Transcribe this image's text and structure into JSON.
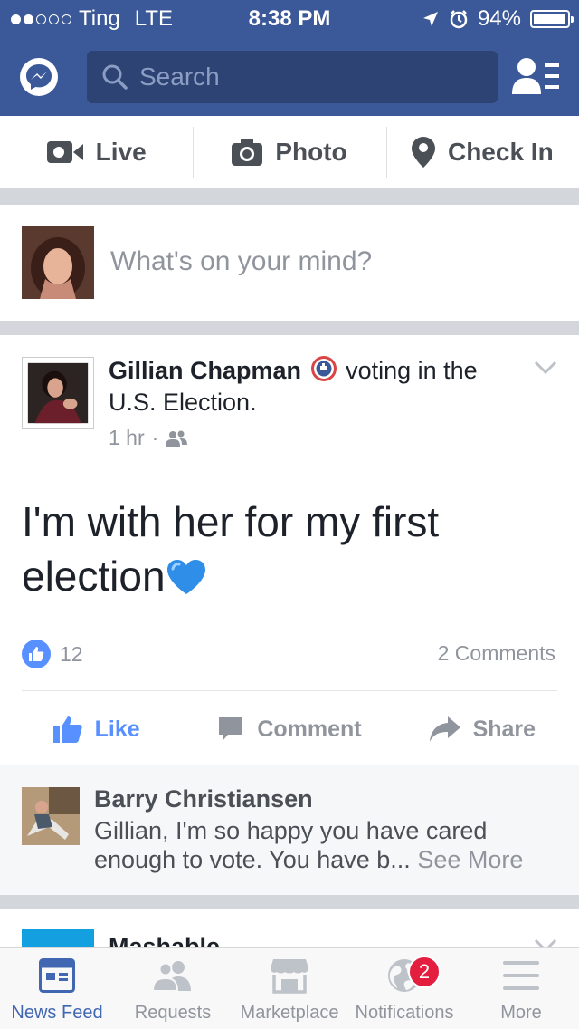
{
  "status_bar": {
    "carrier": "Ting",
    "network": "LTE",
    "time": "8:38 PM",
    "battery": "94%",
    "battery_level": 0.94,
    "signal_bars_filled": 2,
    "signal_bars_total": 5
  },
  "header": {
    "search_placeholder": "Search",
    "brand_color": "#3b5998"
  },
  "composer": {
    "actions": [
      {
        "label": "Live",
        "icon": "video-camera-icon"
      },
      {
        "label": "Photo",
        "icon": "camera-icon"
      },
      {
        "label": "Check In",
        "icon": "location-pin-icon"
      }
    ],
    "prompt": "What's on your mind?"
  },
  "post": {
    "author": "Gillian Chapman",
    "activity": "voting in the U.S. Election.",
    "time": "1 hr",
    "audience_icon": "friends-icon",
    "text": "I'm with her for my first election",
    "emoji": "blue-heart",
    "likes": "12",
    "comments": "2 Comments",
    "buttons": {
      "like": "Like",
      "comment": "Comment",
      "share": "Share"
    }
  },
  "comment": {
    "author": "Barry Christiansen",
    "text": "Gillian, I'm so happy you have cared enough to vote. You have b...",
    "see_more": "See More"
  },
  "next_post": {
    "author": "Mashable"
  },
  "tabbar": {
    "tabs": [
      {
        "label": "News Feed",
        "icon": "news-feed-icon",
        "active": true
      },
      {
        "label": "Requests",
        "icon": "friend-requests-icon",
        "active": false
      },
      {
        "label": "Marketplace",
        "icon": "marketplace-icon",
        "active": false
      },
      {
        "label": "Notifications",
        "icon": "globe-icon",
        "active": false,
        "badge": "2"
      },
      {
        "label": "More",
        "icon": "menu-icon",
        "active": false
      }
    ]
  }
}
